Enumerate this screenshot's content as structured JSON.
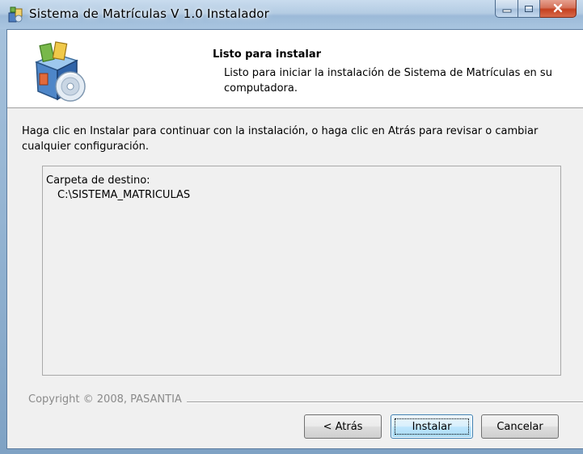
{
  "window": {
    "title": "Sistema de Matrículas V 1.0 Instalador",
    "title_icon": "installer-icon",
    "controls": {
      "minimize": "minimize-icon",
      "maximize": "maximize-icon",
      "close": "close-icon"
    }
  },
  "header": {
    "title": "Listo para instalar",
    "subtitle": "Listo para iniciar la instalación de Sistema de Matrículas en su computadora.",
    "graphic": "install-package-icon"
  },
  "body": {
    "instructions": "Haga clic en Instalar para continuar con la instalación, o haga clic en Atrás para revisar o cambiar cualquier configuración.",
    "destination_label": "Carpeta de destino:",
    "destination_path": "C:\\SISTEMA_MATRICULAS"
  },
  "footer": {
    "copyright": "Copyright © 2008, PASANTIA"
  },
  "buttons": {
    "back": "< Atrás",
    "install": "Instalar",
    "cancel": "Cancelar"
  },
  "colors": {
    "titlebar": "#b4cce3",
    "dialog_background": "#f0f0f0",
    "header_background": "#ffffff",
    "close_button": "#c4401f",
    "default_button_border": "#3c7fb1"
  }
}
